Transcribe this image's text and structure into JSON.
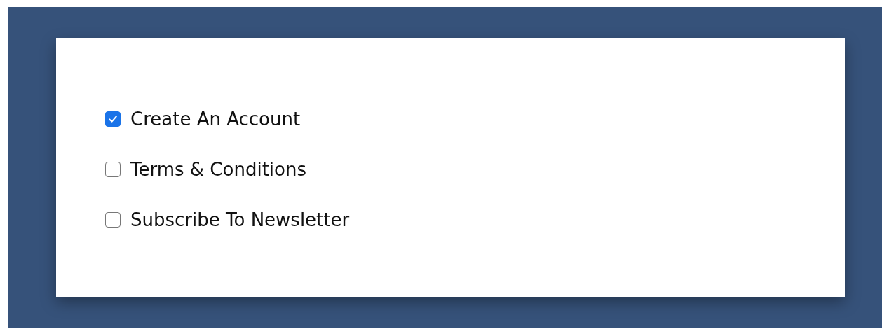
{
  "options": [
    {
      "label": "Create An Account",
      "checked": true
    },
    {
      "label": "Terms & Conditions",
      "checked": false
    },
    {
      "label": "Subscribe To Newsletter",
      "checked": false
    }
  ]
}
